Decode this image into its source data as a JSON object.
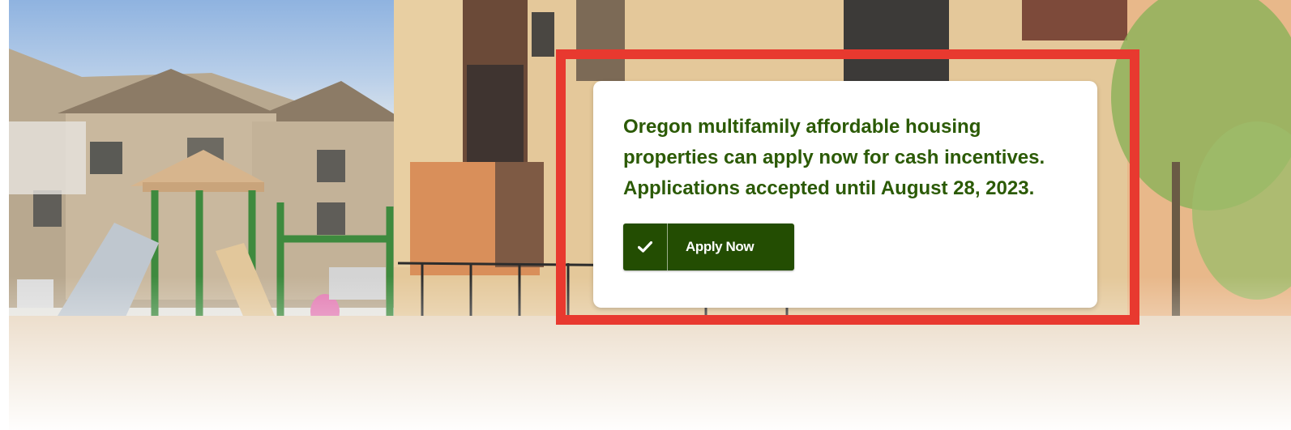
{
  "hero": {
    "image_description_icon": "apartment-playground-photo"
  },
  "promo": {
    "line1": "Oregon multifamily affordable housing",
    "line2": "properties can apply now for cash incentives.",
    "line3": "Applications accepted until August 28, 2023.",
    "button_label": "Apply Now",
    "button_icon": "checkmark-icon"
  },
  "colors": {
    "highlight": "#e8392f",
    "text_green": "#2b5a05",
    "button_green": "#234d02"
  }
}
